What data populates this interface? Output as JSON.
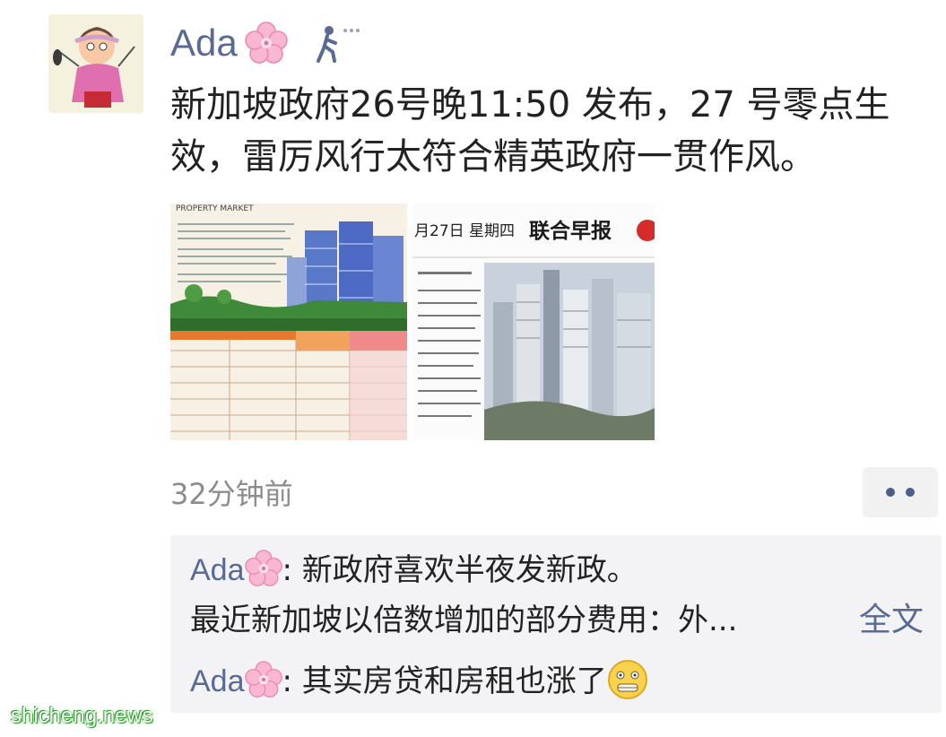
{
  "post": {
    "author": "Ada",
    "text_line1": "新加坡政府26号晚11:50 发布，27 号零点生",
    "text_line2": "效，雷厉风行太符合精英政府一贯作风。",
    "time": "32分钟前",
    "images": [
      {
        "caption": "PROPERTY MARKET"
      },
      {
        "header_date": "月27日 星期四",
        "header_masthead": "联合早报"
      }
    ]
  },
  "comments": [
    {
      "author": "Ada",
      "text": ": 新政府喜欢半夜发新政。"
    },
    {
      "text": "最近新加坡以倍数增加的部分费用：外...",
      "expand_label": "全文"
    },
    {
      "author": "Ada",
      "text": ": 其实房贷和房租也涨了"
    }
  ],
  "watermark": "shicheng.news",
  "icons": {
    "flower": "cherry-blossom-icon",
    "status": "walking-person-icon",
    "more": "more-dots-icon",
    "emoji": "grimace-emoji-icon"
  },
  "colors": {
    "link_blue": "#576b95",
    "comment_bg": "#f3f3f5",
    "text": "#222222",
    "time_gray": "#8c8c8c"
  }
}
